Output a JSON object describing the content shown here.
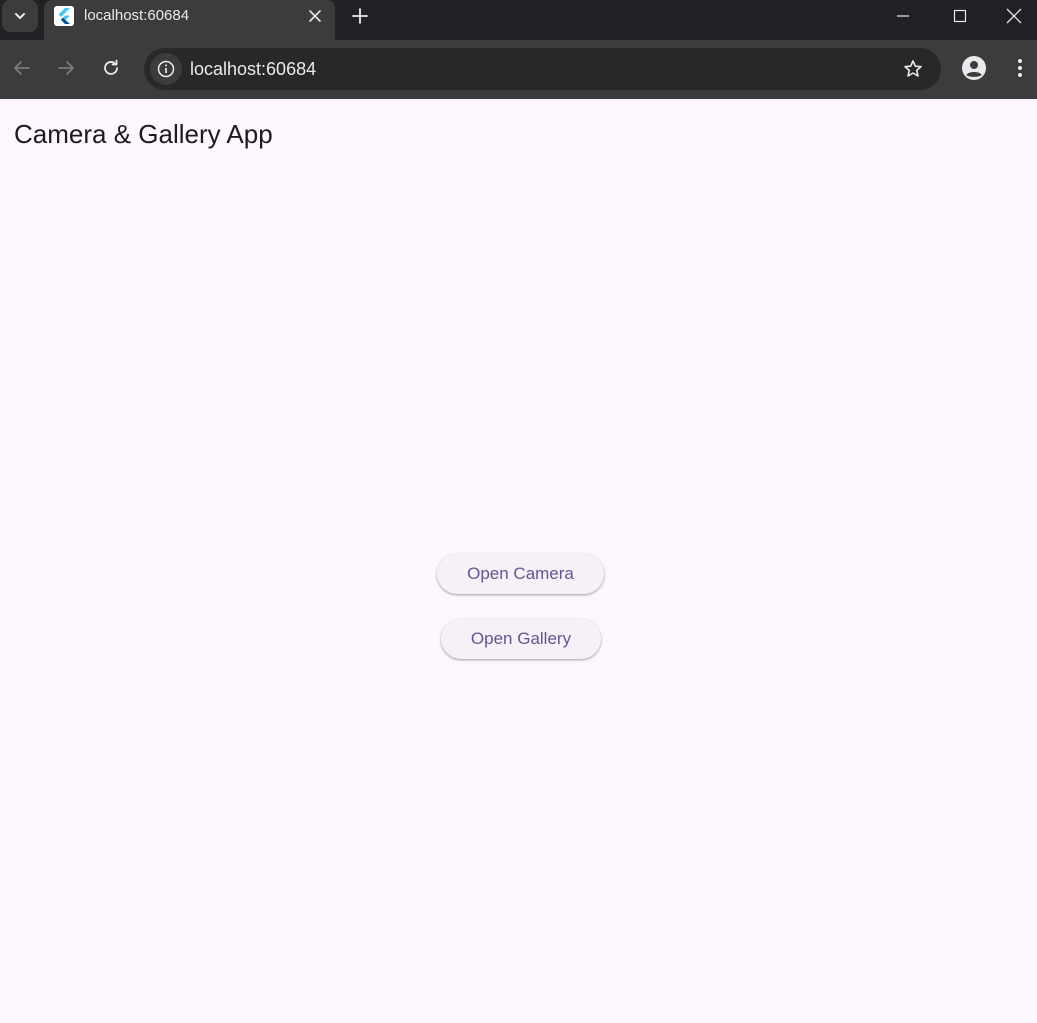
{
  "browser": {
    "tab_title": "localhost:60684",
    "url": "localhost:60684"
  },
  "app": {
    "title": "Camera & Gallery App",
    "open_camera_label": "Open Camera",
    "open_gallery_label": "Open Gallery"
  },
  "colors": {
    "page_background": "#fdf7fd",
    "button_text": "#65558f",
    "button_background": "#f6f1f8"
  }
}
